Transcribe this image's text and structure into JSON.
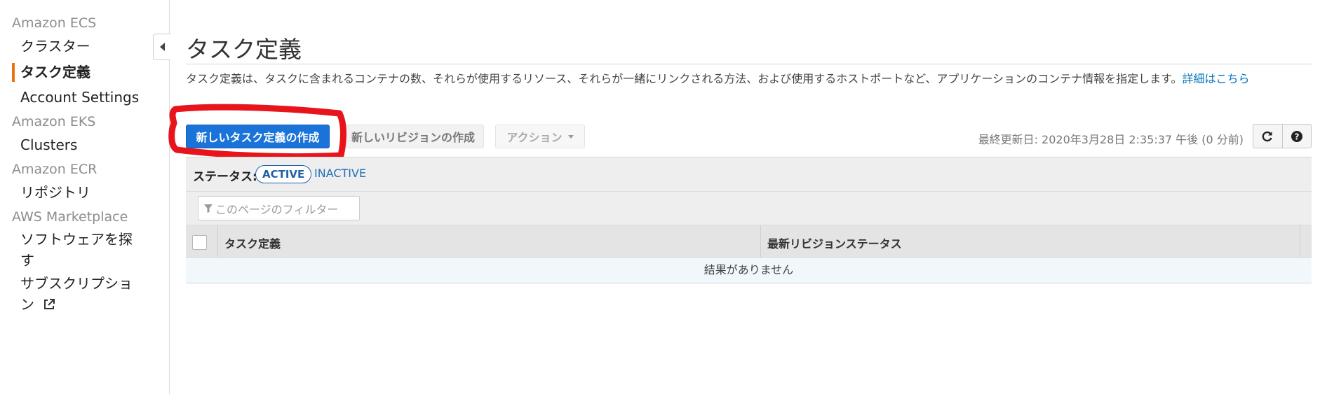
{
  "sidebar": {
    "sections": [
      {
        "title": "Amazon ECS"
      },
      {
        "title": "Amazon EKS"
      },
      {
        "title": "Amazon ECR"
      },
      {
        "title": "AWS Marketplace"
      }
    ],
    "items": {
      "cluster": "クラスター",
      "task_def": "タスク定義",
      "account_settings": "Account Settings",
      "clusters": "Clusters",
      "repository": "リポジトリ",
      "find_software_1": "ソフトウェアを探",
      "find_software_2": "す",
      "subscriptions_1": "サブスクリプショ",
      "subscriptions_2": "ン"
    },
    "active_item": "タスク定義",
    "accent_color": "#ec7211"
  },
  "page": {
    "title": "タスク定義",
    "description": "タスク定義は、タスクに含まれるコンテナの数、それらが使用するリソース、それらが一緒にリンクされる方法、および使用するホストポートなど、アプリケーションのコンテナ情報を指定します。",
    "learn_more": "詳細はこちら"
  },
  "toolbar": {
    "create_new": "新しいタスク定義の作成",
    "create_revision": "新しいリビジョンの作成",
    "actions": "アクション",
    "last_updated": "最終更新日: 2020年3月28日 2:35:37 午後 (0 分前)",
    "primary_color": "#1a73d8",
    "annotation_color": "#e8141c"
  },
  "filters": {
    "status_label": "ステータス:",
    "active": "ACTIVE",
    "inactive": "INACTIVE",
    "search_placeholder": "このページのフィルター"
  },
  "table": {
    "columns": [
      "タスク定義",
      "最新リビジョンステータス"
    ],
    "empty_message": "結果がありません"
  }
}
